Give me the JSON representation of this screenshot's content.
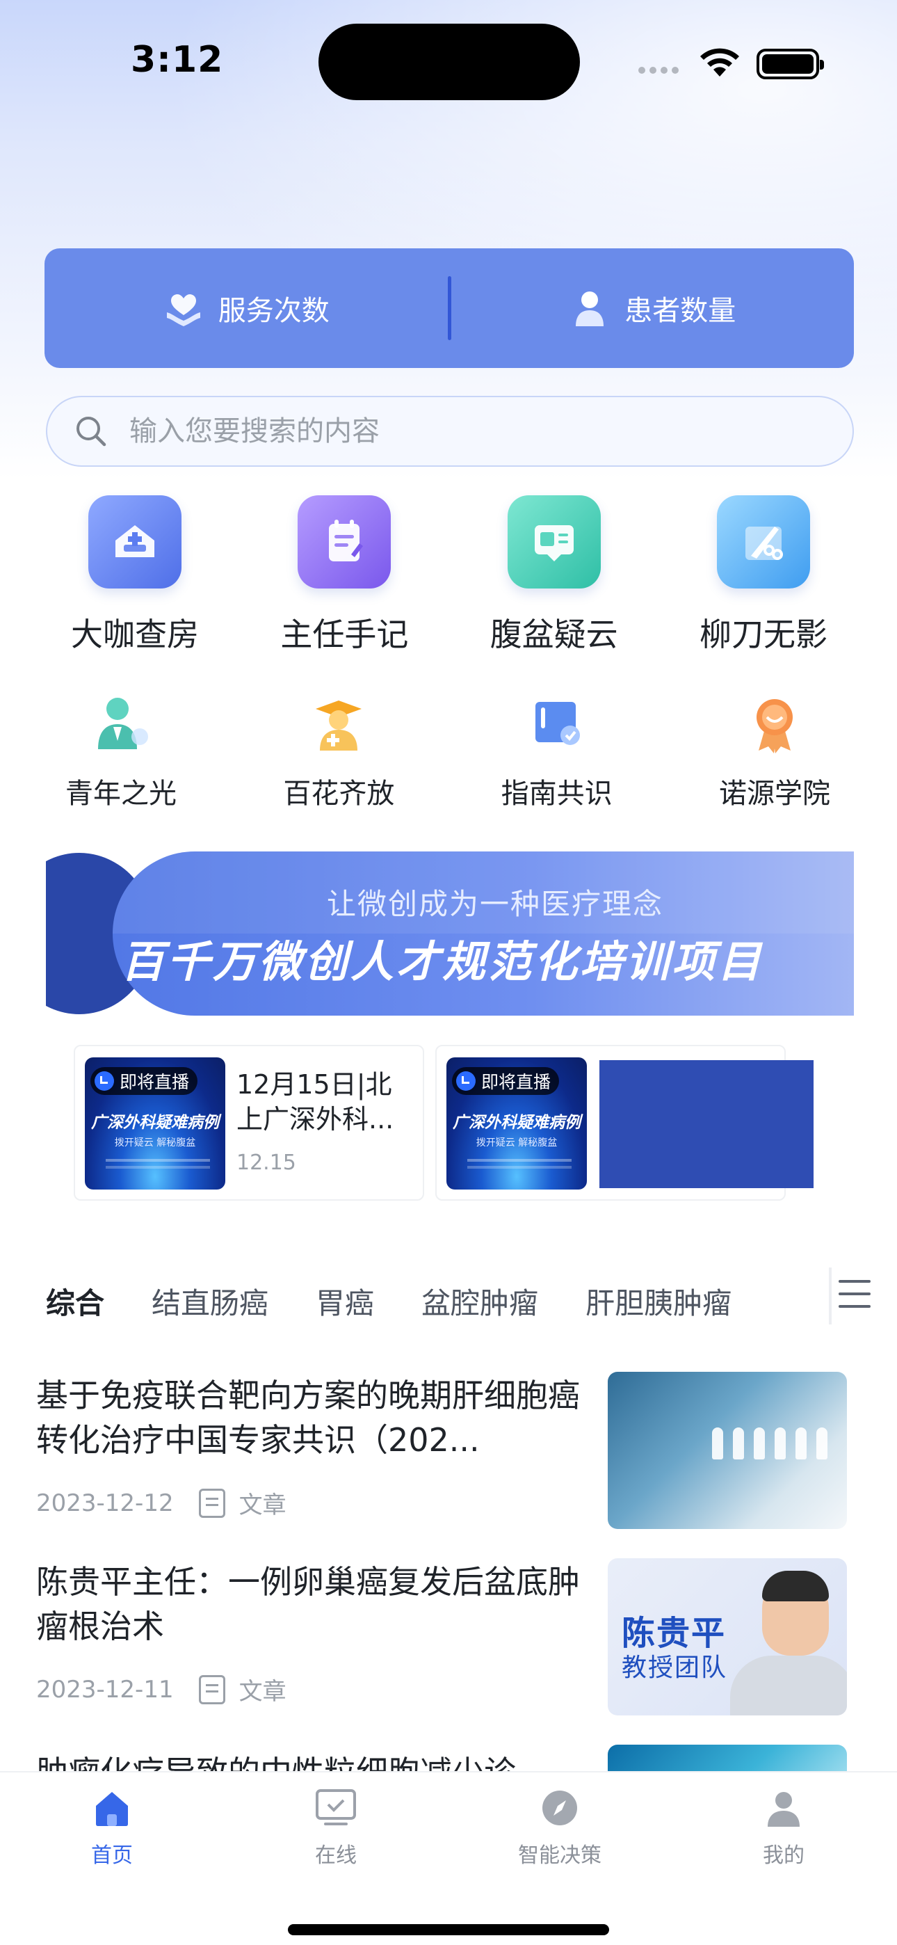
{
  "status_bar": {
    "time": "3:12"
  },
  "stats": [
    {
      "label": "服务次数",
      "icon": "heart-hands-icon"
    },
    {
      "label": "患者数量",
      "icon": "patient-icon"
    }
  ],
  "search": {
    "placeholder": "输入您要搜索的内容"
  },
  "quick_main": [
    {
      "label": "大咖查房",
      "icon": "ward-icon",
      "color": "#5b7cf0"
    },
    {
      "label": "主任手记",
      "icon": "notebook-icon",
      "color": "#8a6cf0"
    },
    {
      "label": "腹盆疑云",
      "icon": "image-icon",
      "color": "#3fcfb6"
    },
    {
      "label": "柳刀无影",
      "icon": "scalpel-icon",
      "color": "#5ab4f7"
    }
  ],
  "quick_sub": [
    {
      "label": "青年之光",
      "icon": "young-doctor-icon"
    },
    {
      "label": "百花齐放",
      "icon": "graduate-icon"
    },
    {
      "label": "指南共识",
      "icon": "guide-book-icon"
    },
    {
      "label": "诺源学院",
      "icon": "medal-icon"
    }
  ],
  "banner": {
    "subtitle": "让微创成为一种医疗理念",
    "title": "百千万微创人才规范化培训项目"
  },
  "live_cards": [
    {
      "tag": "即将直播",
      "thumb_title": "广深外科疑难病例",
      "thumb_sub": "拨开疑云  解秘腹盆",
      "title": "12月15日|北上广深外科...",
      "date": "12.15"
    },
    {
      "tag": "即将直播",
      "thumb_title": "广深外科疑难病例",
      "thumb_sub": "拨开疑云  解秘腹盆"
    }
  ],
  "category_tabs": [
    "综合",
    "结直肠癌",
    "胃癌",
    "盆腔肿瘤",
    "肝胆胰肿瘤"
  ],
  "news": [
    {
      "title": "基于免疫联合靶向方案的晚期肝细胞癌转化治疗中国专家共识（202...",
      "date": "2023-12-12",
      "type": "文章"
    },
    {
      "title": "陈贵平主任：一例卵巢癌复发后盆底肿瘤根治术",
      "date": "2023-12-11",
      "type": "文章",
      "image_name": "陈贵平",
      "image_team": "教授团队"
    },
    {
      "title": "肿瘤化疗导致的中性粒细胞减少诊"
    }
  ],
  "tabbar": [
    {
      "label": "首页",
      "icon": "home-icon",
      "active": true
    },
    {
      "label": "在线",
      "icon": "monitor-icon",
      "active": false
    },
    {
      "label": "智能决策",
      "icon": "compass-icon",
      "active": false
    },
    {
      "label": "我的",
      "icon": "profile-icon",
      "active": false
    }
  ],
  "colors": {
    "accent": "#3667e8",
    "stats_bg": "#6a8bea",
    "inactive": "#8b9099"
  }
}
